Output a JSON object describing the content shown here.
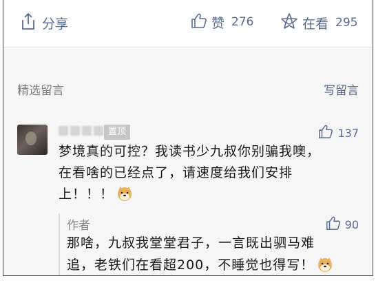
{
  "actions": {
    "share_label": "分享",
    "like_label": "赞",
    "like_count": "276",
    "wow_label": "在看",
    "wow_count": "295"
  },
  "comments_section": {
    "title": "精选留言",
    "write_label": "写留言"
  },
  "comment": {
    "pin_label": "置顶",
    "like_count": "137",
    "text_lines": [
      "梦境真的可控？我读书少九叔你别骗我噢，",
      "在看啥的已经点了，请速度给我们安排",
      "上！！！"
    ],
    "emoji": "doge-emoji"
  },
  "reply": {
    "author": "作者",
    "like_count": "90",
    "text_lines": [
      "那啥，九叔我堂堂君子，一言既出驷马难",
      "追，老铁们在看超200，不睡觉也得写！"
    ],
    "emoji": "doge-emoji"
  },
  "colors": {
    "link": "#576b95",
    "muted": "#7f7f7f",
    "section_bg": "#f6f6f6",
    "pin_bg": "#c6c6c6"
  }
}
